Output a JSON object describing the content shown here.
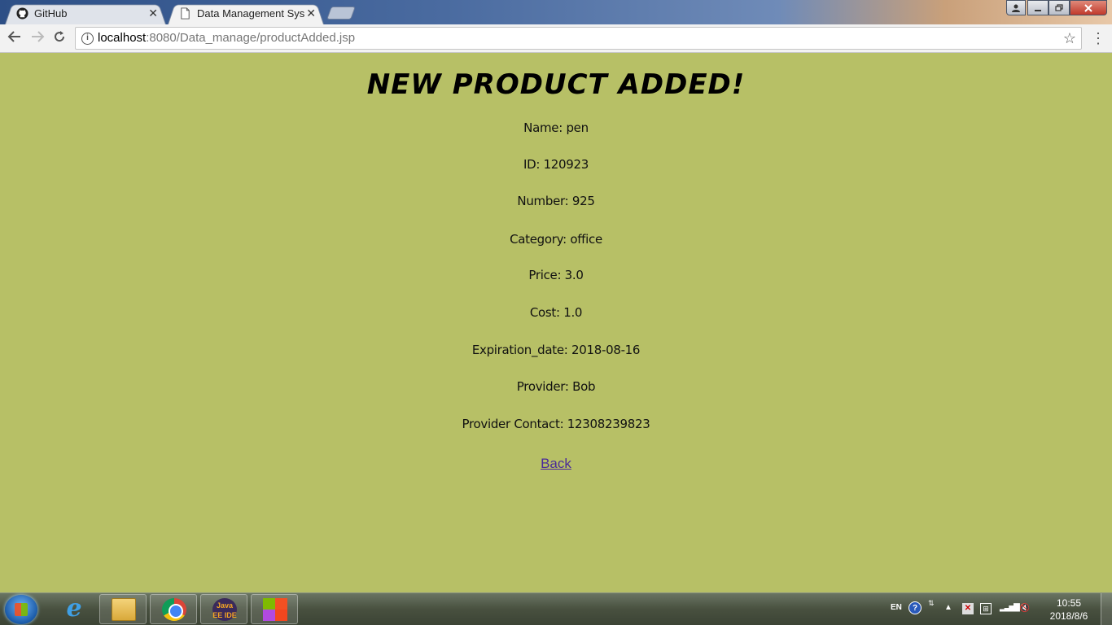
{
  "browser": {
    "tabs": [
      {
        "label": "GitHub",
        "icon": "github-icon",
        "active": false
      },
      {
        "label": "Data Management Syst",
        "icon": "page-icon",
        "active": true
      }
    ],
    "url_host": "localhost",
    "url_rest": ":8080/Data_manage/productAdded.jsp",
    "tab_close": "✕"
  },
  "page": {
    "title": "NEW PRODUCT ADDED!",
    "fields": {
      "name": "Name: pen",
      "id": "ID: 120923",
      "number": "Number: 925",
      "category": "Category: office",
      "price": "Price: 3.0",
      "cost": "Cost: 1.0",
      "expiration_date": "Expiration_date: 2018-08-16",
      "provider": "Provider: Bob",
      "provider_contact": "Provider Contact: 12308239823"
    },
    "back_link": "Back",
    "background_color": "#b7c066"
  },
  "taskbar": {
    "lang": "EN",
    "clock_time": "10:55",
    "clock_date": "2018/8/6",
    "javaee_label": "Java EE IDE"
  }
}
